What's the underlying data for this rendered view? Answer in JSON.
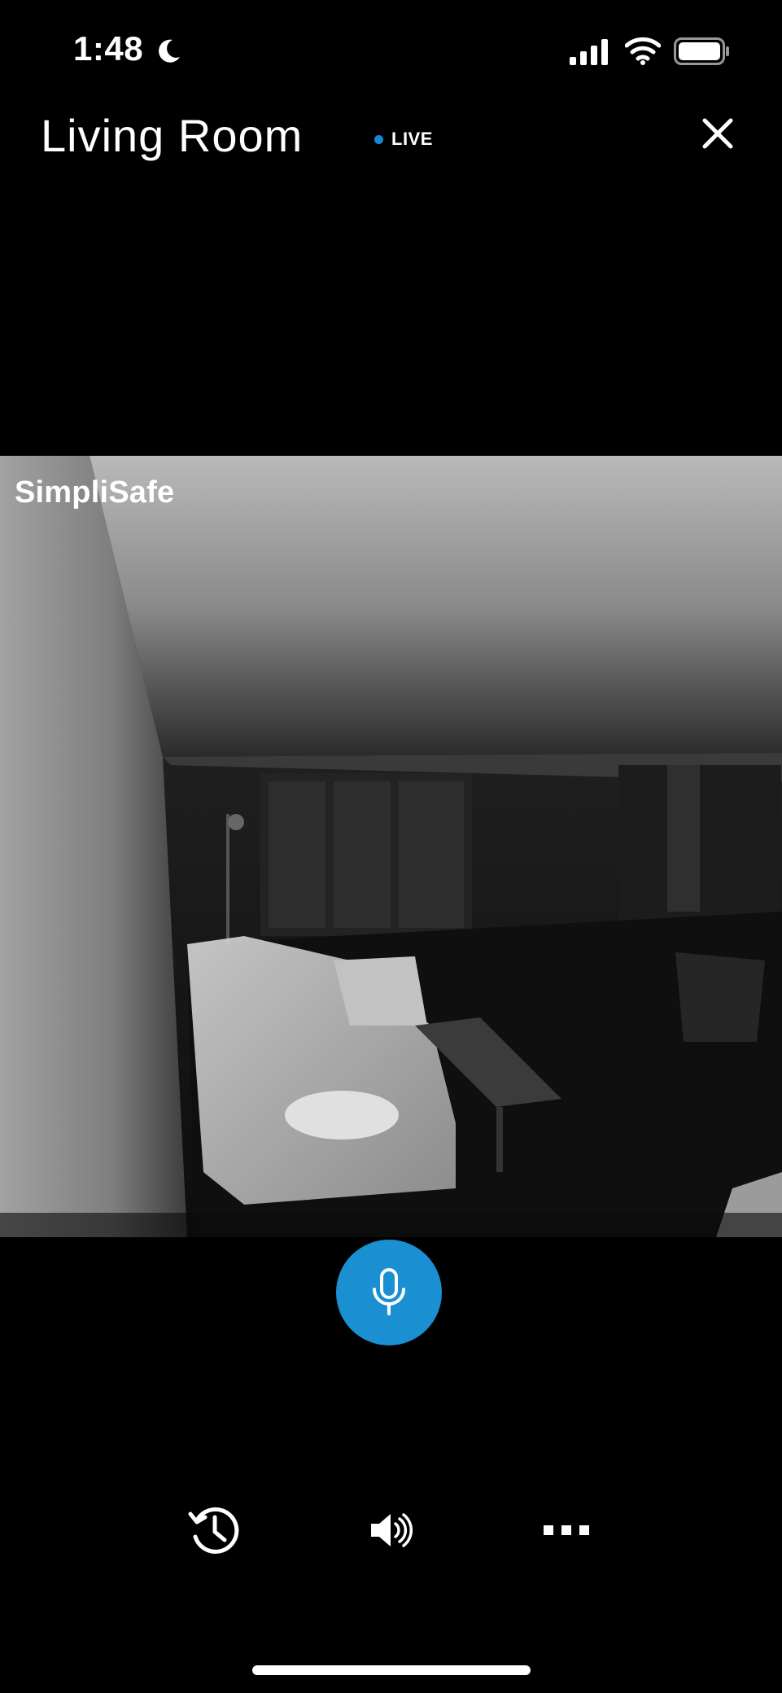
{
  "status_bar": {
    "time": "1:48",
    "icons": [
      "moon-icon",
      "signal-icon",
      "wifi-icon",
      "battery-icon"
    ]
  },
  "header": {
    "title": "Living Room",
    "live_label": "LIVE",
    "close_icon": "close-icon"
  },
  "camera": {
    "watermark": "SimpliSafe"
  },
  "controls": {
    "mic_icon": "microphone-icon"
  },
  "toolbar": {
    "items": [
      {
        "icon": "history-icon"
      },
      {
        "icon": "speaker-icon"
      },
      {
        "icon": "more-icon"
      }
    ]
  },
  "colors": {
    "accent": "#1a8fd1",
    "live_dot": "#1a86d6",
    "background": "#000000",
    "text": "#ffffff"
  }
}
